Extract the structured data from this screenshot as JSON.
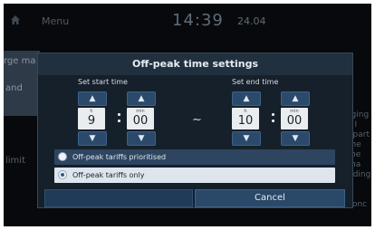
{
  "status_bar": {
    "menu_label": "Menu",
    "time": "14:39",
    "date": "24.04"
  },
  "background": {
    "left_text_1": "rge ma",
    "left_text_2": "and",
    "left_text_3": "limit",
    "right_lines": [
      "rging",
      "s I",
      "epart",
      "the",
      "me ma",
      "nding",
      "s",
      "g conc"
    ]
  },
  "dialog": {
    "title": "Off-peak time settings",
    "start": {
      "label": "Set start time",
      "hour_unit": "h",
      "hour": "9",
      "min_unit": "min",
      "min": "00"
    },
    "separator": "~",
    "end": {
      "label": "Set end time",
      "hour_unit": "h",
      "hour": "10",
      "min_unit": "min",
      "min": "00"
    },
    "options": [
      {
        "label": "Off-peak tariffs prioritised",
        "selected": false
      },
      {
        "label": "Off-peak tariffs only",
        "selected": true
      }
    ],
    "ok_label": "",
    "cancel_label": "Cancel"
  },
  "arrow_up": "▲",
  "arrow_down": "▼"
}
